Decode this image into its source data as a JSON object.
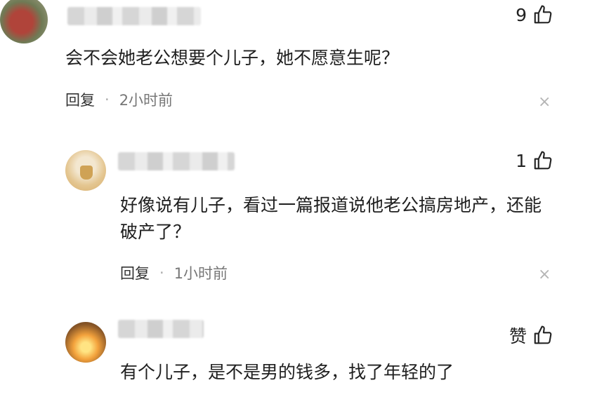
{
  "comments": [
    {
      "text": "会不会她老公想要个儿子，她不愿意生呢？",
      "like_count": "9",
      "reply_label": "回复",
      "separator": "·",
      "time": "2小时前",
      "close_glyph": "×"
    },
    {
      "text": "好像说有儿子，看过一篇报道说他老公搞房地产，还能破产了？",
      "like_count": "1",
      "reply_label": "回复",
      "separator": "·",
      "time": "1小时前",
      "close_glyph": "×"
    },
    {
      "text": "有个儿子，是不是男的钱多，找了年轻的了",
      "like_label": "赞"
    }
  ],
  "icons": {
    "like": "thumbs-up-icon",
    "close": "close-icon"
  }
}
